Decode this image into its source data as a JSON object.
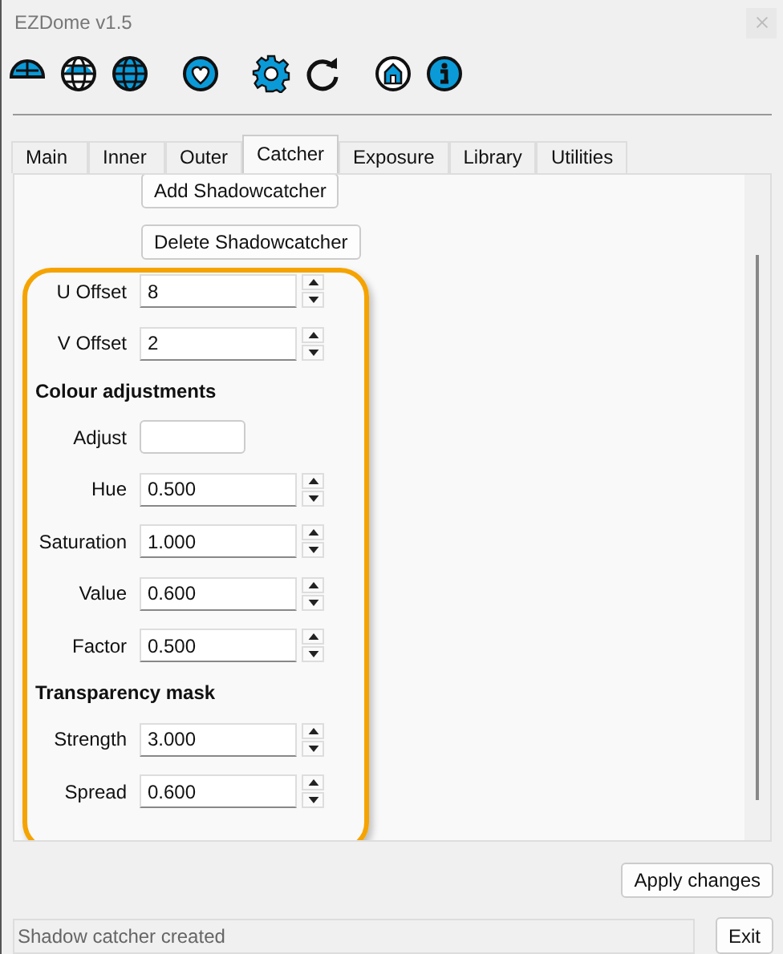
{
  "window": {
    "title": "EZDome v1.5"
  },
  "tabs": [
    {
      "label": "Main",
      "selected": false
    },
    {
      "label": "Inner",
      "selected": false
    },
    {
      "label": "Outer",
      "selected": false
    },
    {
      "label": "Catcher",
      "selected": true
    },
    {
      "label": "Exposure",
      "selected": false
    },
    {
      "label": "Library",
      "selected": false
    },
    {
      "label": "Utilities",
      "selected": false
    }
  ],
  "buttons": [
    "Add Shadowcatcher",
    "Delete Shadowcatcher"
  ],
  "rows": [
    {
      "kind": "spin",
      "label": "U Offset",
      "value": "8"
    },
    {
      "kind": "spin",
      "label": "V Offset",
      "value": "2"
    },
    {
      "kind": "section",
      "label": "Colour adjustments"
    },
    {
      "kind": "field",
      "label": "Adjust"
    },
    {
      "kind": "spin",
      "label": "Hue",
      "value": "0.500"
    },
    {
      "kind": "spin",
      "label": "Saturation",
      "value": "1.000"
    },
    {
      "kind": "spin",
      "label": "Value",
      "value": "0.600"
    },
    {
      "kind": "spin",
      "label": "Factor",
      "value": "0.500"
    },
    {
      "kind": "section",
      "label": "Transparency mask"
    },
    {
      "kind": "spin",
      "label": "Strength",
      "value": "3.000"
    },
    {
      "kind": "spin",
      "label": "Spread",
      "value": "0.600"
    }
  ],
  "apply_button": "Apply changes",
  "status_bar": "Shadow catcher created",
  "exit_button": "Exit"
}
